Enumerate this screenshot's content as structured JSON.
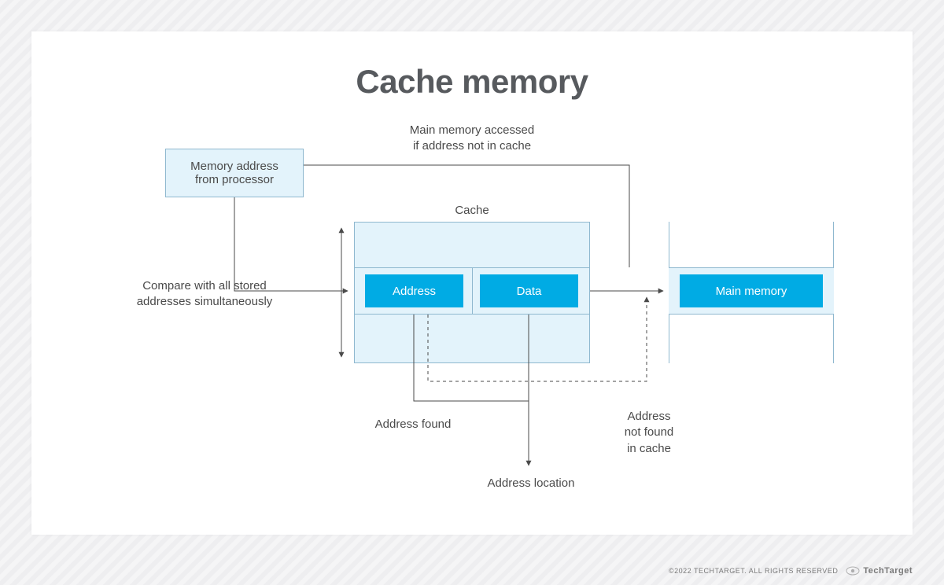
{
  "title": "Cache memory",
  "boxes": {
    "processor_box": "Memory address\nfrom processor",
    "cache_label": "Cache",
    "address_block": "Address",
    "data_block": "Data",
    "main_memory_block": "Main memory"
  },
  "annotations": {
    "main_memory_accessed": "Main memory accessed\nif address not in cache",
    "compare_all": "Compare with all stored\naddresses simultaneously",
    "address_found": "Address found",
    "address_location": "Address location",
    "address_not_found": "Address\nnot found\nin cache"
  },
  "footer": {
    "copyright": "©2022 TechTarget. All rights reserved",
    "brand": "TechTarget"
  },
  "colors": {
    "light_blue": "#e3f3fb",
    "cyan": "#00abe4",
    "text": "#4a4a4a"
  }
}
